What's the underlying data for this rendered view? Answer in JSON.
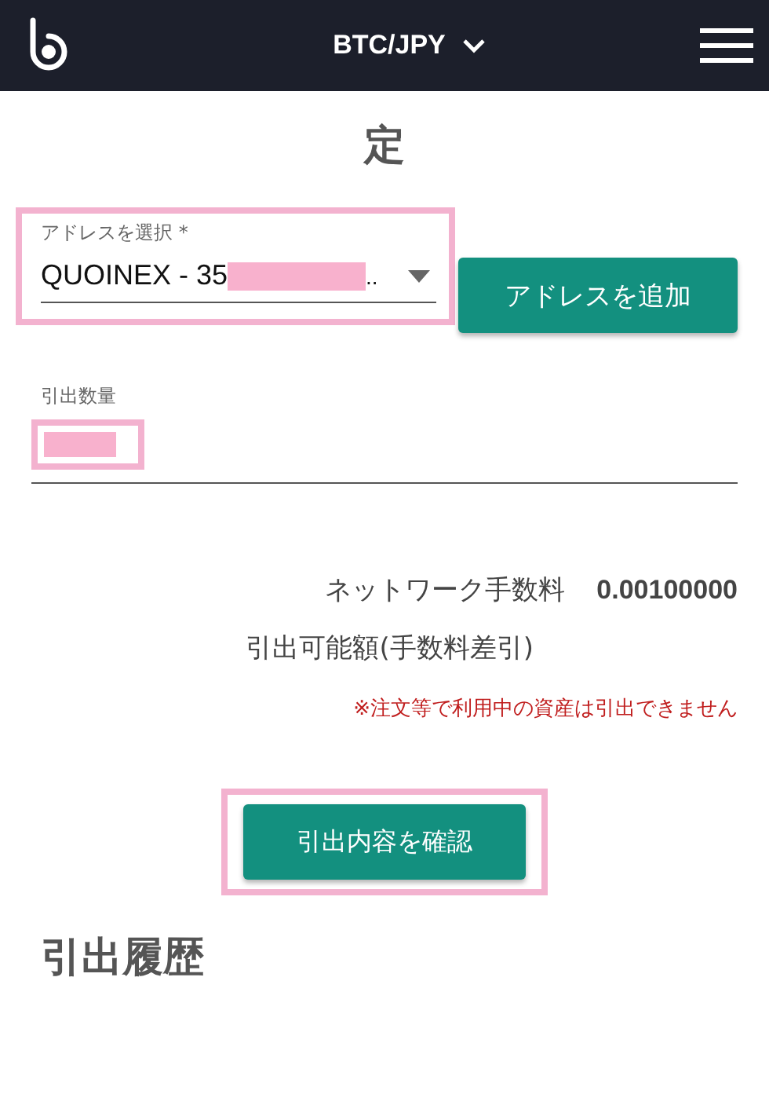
{
  "header": {
    "pair": "BTC/JPY"
  },
  "title": "定",
  "address": {
    "label": "アドレスを選択 *",
    "value": "QUOINEX - 35",
    "ellipsis": ".."
  },
  "add_button": "アドレスを追加",
  "amount": {
    "label": "引出数量"
  },
  "fee": {
    "label": "ネットワーク手数料",
    "value": "0.00100000"
  },
  "available": {
    "label": "引出可能額(手数料差引)"
  },
  "note": "※注文等で利用中の資産は引出できません",
  "confirm_button": "引出内容を確認",
  "history_heading": "引出履歴"
}
